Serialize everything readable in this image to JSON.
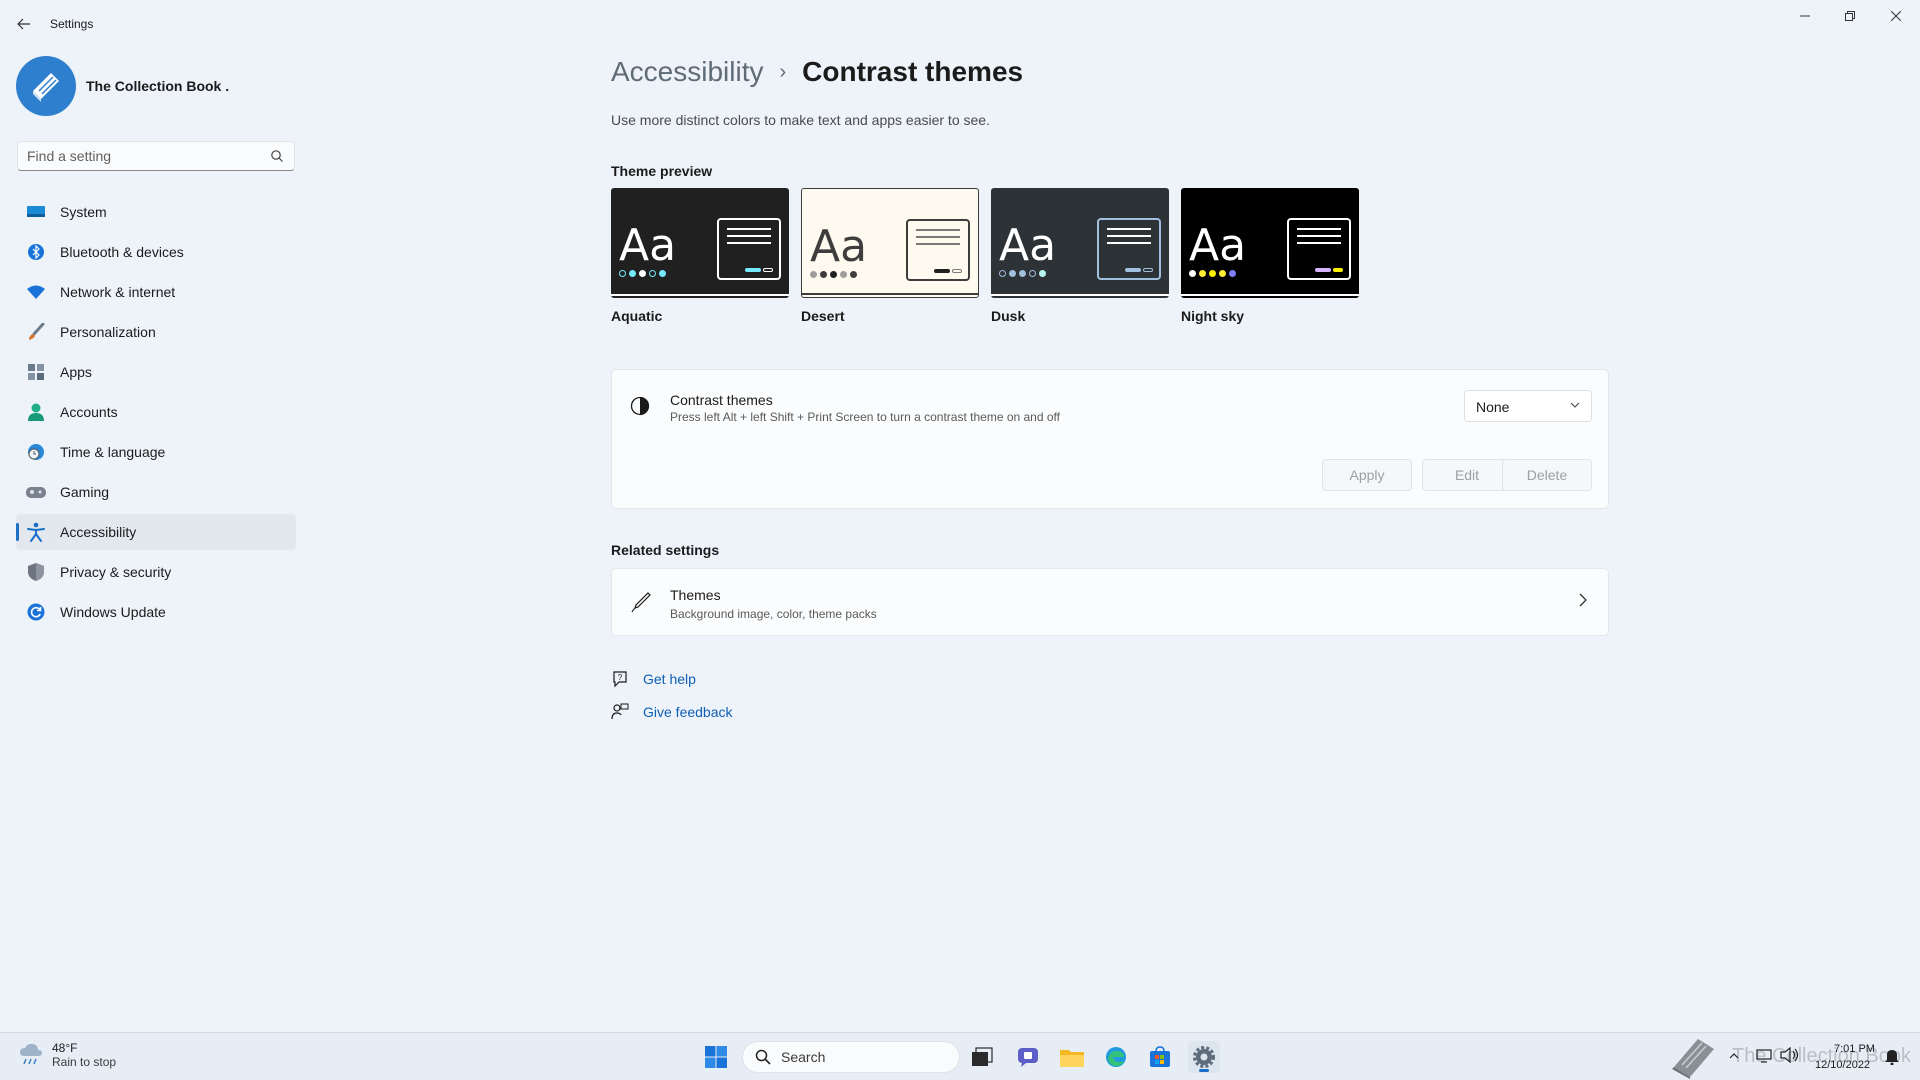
{
  "window": {
    "title": "Settings"
  },
  "profile": {
    "name": "The Collection Book ."
  },
  "search": {
    "placeholder": "Find a setting"
  },
  "sidebar": {
    "items": [
      {
        "label": "System",
        "icon": "monitor-icon",
        "color": "#1a8ad4"
      },
      {
        "label": "Bluetooth & devices",
        "icon": "bluetooth-icon",
        "color": "#1a73d9"
      },
      {
        "label": "Network & internet",
        "icon": "wifi-icon",
        "color": "#1a73d9"
      },
      {
        "label": "Personalization",
        "icon": "brush-icon",
        "color": "#d9742a"
      },
      {
        "label": "Apps",
        "icon": "apps-icon",
        "color": "#5b6b7d"
      },
      {
        "label": "Accounts",
        "icon": "person-icon",
        "color": "#1fae88"
      },
      {
        "label": "Time & language",
        "icon": "globe-clock-icon",
        "color": "#2a88d8"
      },
      {
        "label": "Gaming",
        "icon": "gamepad-icon",
        "color": "#7a8290"
      },
      {
        "label": "Accessibility",
        "icon": "accessibility-icon",
        "color": "#1a6ec9",
        "active": true
      },
      {
        "label": "Privacy & security",
        "icon": "shield-icon",
        "color": "#6b7480"
      },
      {
        "label": "Windows Update",
        "icon": "update-icon",
        "color": "#1a73d9"
      }
    ]
  },
  "main": {
    "breadcrumb_parent": "Accessibility",
    "breadcrumb_sep": "›",
    "title": "Contrast themes",
    "description": "Use more distinct colors to make text and apps easier to see.",
    "preview_heading": "Theme preview",
    "themes": [
      {
        "name": "Aquatic",
        "bg": "#202020",
        "fg": "#ffffff",
        "accent": "#75e9fc",
        "accent2": "#ffffff",
        "dots": [
          "#202020",
          "#75e9fc",
          "#ffffff",
          "#202020",
          "#75e9fc"
        ]
      },
      {
        "name": "Desert",
        "bg": "#fffaef",
        "fg": "#3d3d3d",
        "accent": "#202020",
        "accent2": "#a0a0a0",
        "dots": [
          "#9e9e9e",
          "#3d3d3d",
          "#202020",
          "#9e9e9e",
          "#3d3d3d"
        ]
      },
      {
        "name": "Dusk",
        "bg": "#2d3236",
        "fg": "#ffffff",
        "accent": "#a1bfde",
        "accent2": "#b6f6f0",
        "dots": [
          "#2d3236",
          "#a1bfde",
          "#a1bfde",
          "#2d3236",
          "#b6f6f0"
        ]
      },
      {
        "name": "Night sky",
        "bg": "#000000",
        "fg": "#ffffff",
        "accent": "#d6b4fd",
        "accent2": "#fff000",
        "dots": [
          "#ffffff",
          "#ffee32",
          "#fff000",
          "#ffee32",
          "#8080ff"
        ]
      }
    ],
    "contrast_card": {
      "title": "Contrast themes",
      "subtitle": "Press left Alt + left Shift + Print Screen to turn a contrast theme on and off",
      "dropdown_value": "None",
      "apply": "Apply",
      "edit": "Edit",
      "delete": "Delete"
    },
    "related_heading": "Related settings",
    "related": {
      "title": "Themes",
      "subtitle": "Background image, color, theme packs"
    },
    "help": {
      "get_help": "Get help",
      "feedback": "Give feedback"
    }
  },
  "taskbar": {
    "weather_temp": "48°F",
    "weather_cond": "Rain to stop",
    "search": "Search",
    "tray_text": "The Collection Book",
    "time": "7:01 PM",
    "date": "12/10/2022"
  }
}
